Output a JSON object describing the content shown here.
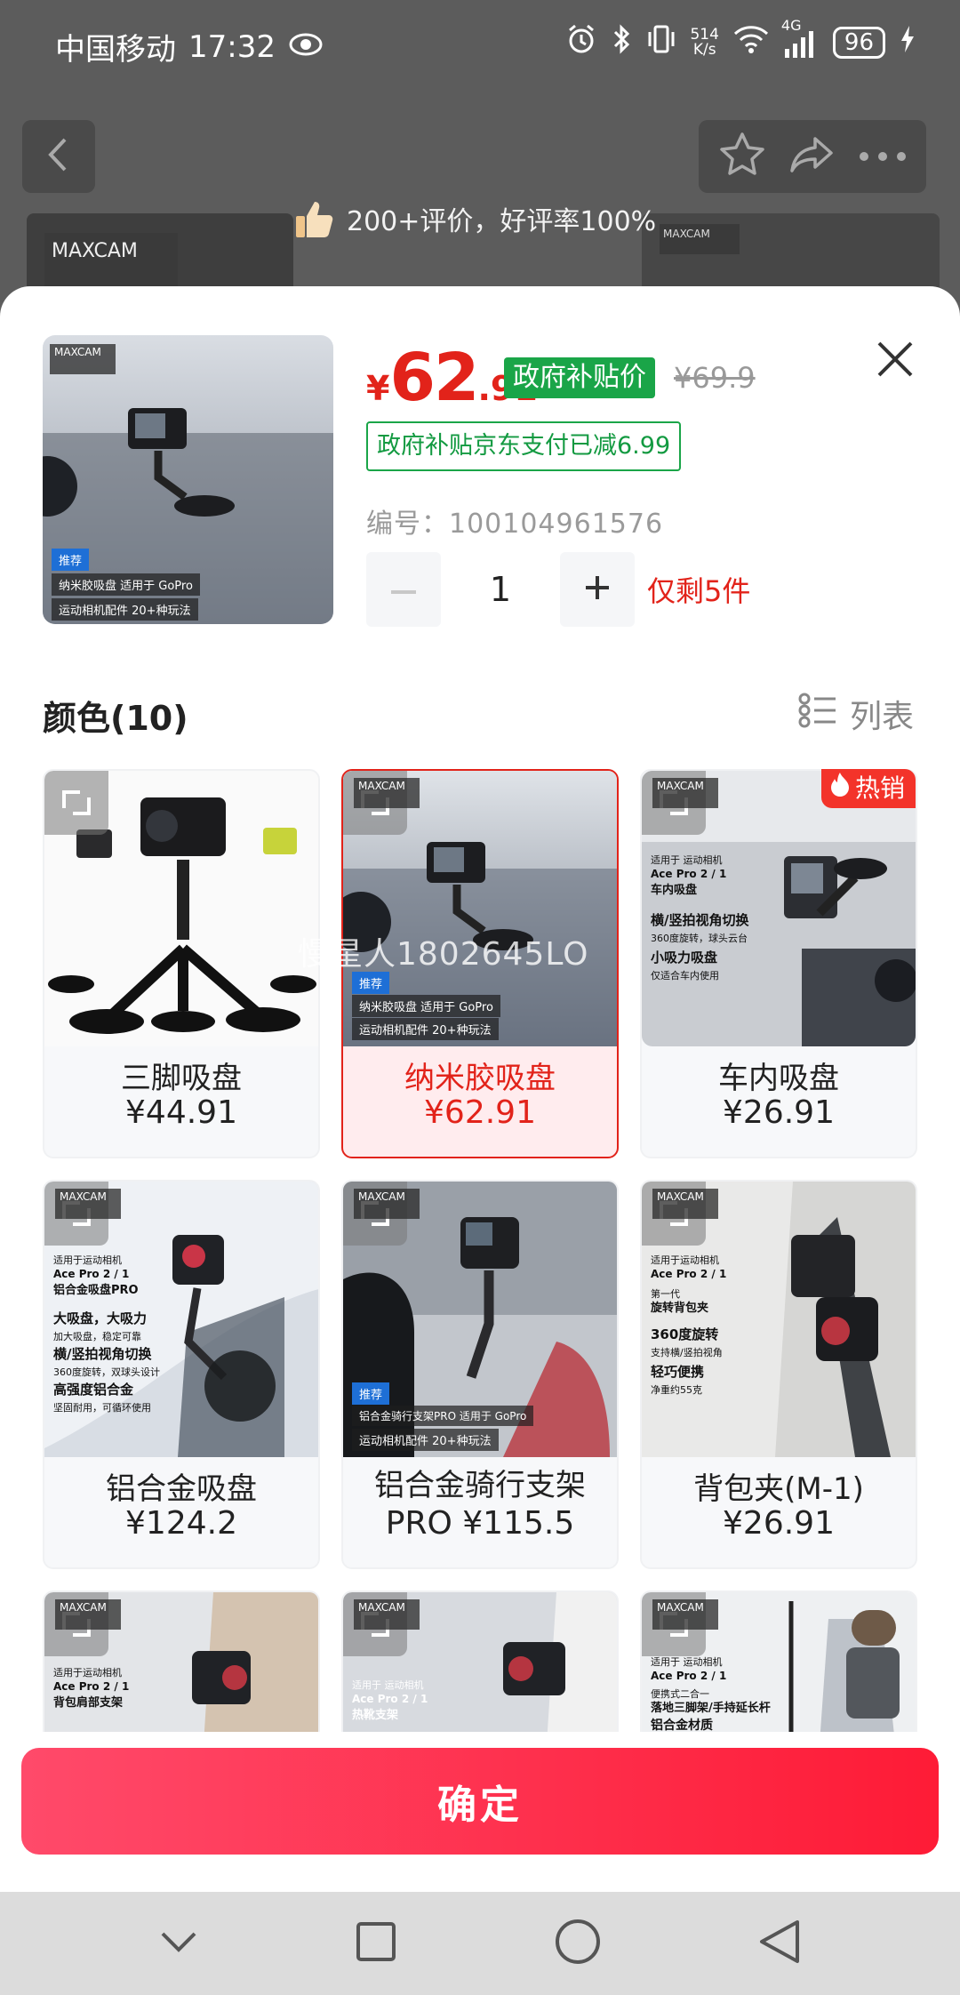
{
  "status": {
    "carrier": "中国移动",
    "time": "17:32",
    "speed_value": "514",
    "speed_unit": "K/s",
    "network": "4G",
    "battery": "96"
  },
  "banner": {
    "review_text": "200+评价，好评率100%",
    "logo_text": "MAXCAM"
  },
  "product": {
    "price_symbol": "¥",
    "price_int": "62",
    "price_dec": ".91",
    "gov_badge": "政府补贴价",
    "original_price": "¥69.9",
    "subsidy_text": "政府补贴京东支付已减6.99",
    "sku_text": "编号：100104961576",
    "quantity": "1",
    "stock_note": "仅剩5件",
    "thumb_logo": "MAXCAM",
    "thumb_rec": "推荐",
    "thumb_caption1": "纳米胶吸盘 适用于 GoPro",
    "thumb_caption2": "运动相机配件 20+种玩法"
  },
  "section": {
    "title": "颜色(10)",
    "list_label": "列表"
  },
  "watermark": "慢星人1802645LO",
  "hot_tag": "热销",
  "options": [
    {
      "name": "三脚吸盘",
      "price": "¥44.91",
      "selected": false
    },
    {
      "name": "纳米胶吸盘",
      "price": "¥62.91",
      "selected": true
    },
    {
      "name": "车内吸盘",
      "price": "¥26.91",
      "selected": false
    },
    {
      "name": "铝合金吸盘",
      "price": "¥124.2",
      "selected": false
    },
    {
      "name": "铝合金骑行支架",
      "price": "PRO ¥115.5",
      "selected": false
    },
    {
      "name": "背包夹(M-1)",
      "price": "¥26.91",
      "selected": false
    }
  ],
  "card_texts": {
    "c1_logo": "MAXCAM",
    "c2_rec": "推荐",
    "c2_cap1": "纳米胶吸盘 适用于 GoPro",
    "c2_cap2": "运动相机配件 20+种玩法",
    "c3_l1": "适用于 运动相机",
    "c3_l2": "Ace Pro 2 / 1",
    "c3_l3": "车内吸盘",
    "c3_l4": "横/竖拍视角切换",
    "c3_l5": "360度旋转，球头云台",
    "c3_l6": "小吸力吸盘",
    "c3_l7": "仅适合车内使用",
    "c4_l1": "适用于运动相机",
    "c4_l2": "Ace Pro 2 / 1",
    "c4_l3": "铝合金吸盘PRO",
    "c4_l4": "大吸盘，大吸力",
    "c4_l5": "加大吸盘，稳定可靠",
    "c4_l6": "横/竖拍视角切换",
    "c4_l7": "360度旋转，双球头设计",
    "c4_l8": "高强度铝合金",
    "c4_l9": "坚固耐用，可循环使用",
    "c5_rec": "推荐",
    "c5_cap1": "铝合金骑行支架PRO 适用于 GoPro",
    "c5_cap2": "运动相机配件 20+种玩法",
    "c6_l1": "适用于运动相机",
    "c6_l2": "Ace Pro 2 / 1",
    "c6_l3": "第一代",
    "c6_l4": "旋转背包夹",
    "c6_l5": "360度旋转",
    "c6_l6": "支持横/竖拍视角",
    "c6_l7": "轻巧便携",
    "c6_l8": "净重约55克",
    "c7_l1": "适用于运动相机",
    "c7_l2": "Ace Pro 2 / 1",
    "c7_l3": "背包肩部支架",
    "c8_l1": "适用于 运动相机",
    "c8_l2": "Ace Pro 2 / 1",
    "c8_l3": "热靴支架",
    "c9_l1": "适用于 运动相机",
    "c9_l2": "Ace Pro 2 / 1",
    "c9_l3": "便携式二合一",
    "c9_l4": "落地三脚架/手持延长杆",
    "c9_l5": "铝合金材质"
  },
  "confirm_label": "确定",
  "colors": {
    "accent_red": "#e2231a",
    "subsidy_green": "#1aa548",
    "confirm_gradient_start": "#ff4a6a",
    "confirm_gradient_end": "#fe1b36"
  }
}
